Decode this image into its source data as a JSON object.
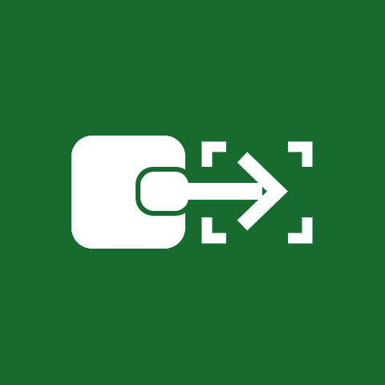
{
  "app_icon": {
    "name": "move-to-frame-icon",
    "background_color": "#176B31",
    "glyph_color": "#FFFFFF"
  }
}
